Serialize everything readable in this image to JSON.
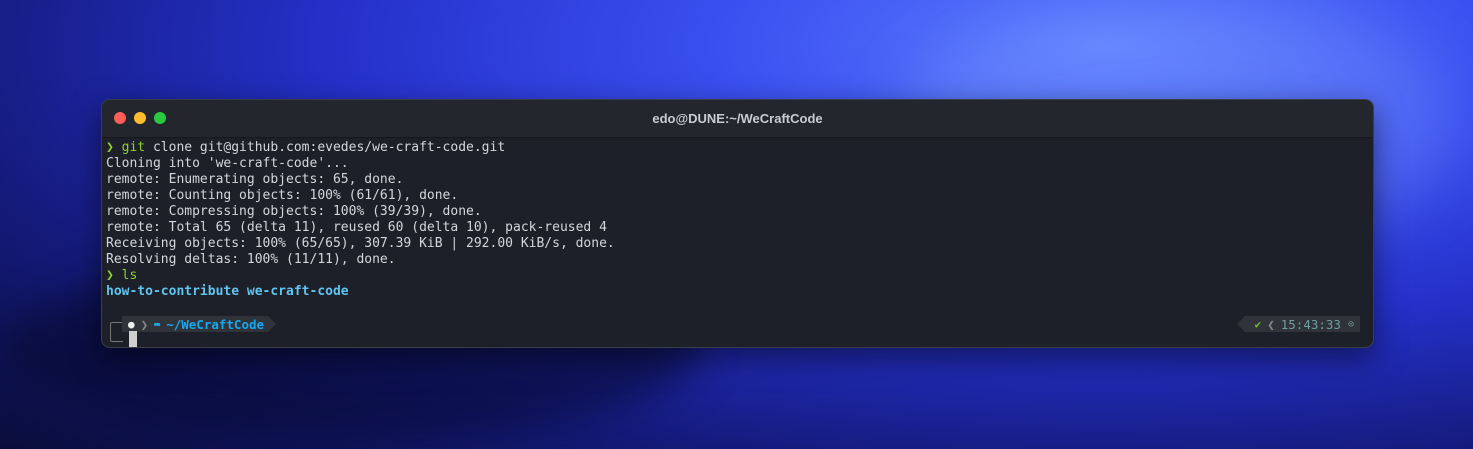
{
  "window": {
    "title": "edo@DUNE:~/WeCraftCode",
    "buttons": {
      "close_color": "#ff5f57",
      "minimize_color": "#febc2e",
      "zoom_color": "#28c840"
    }
  },
  "terminal": {
    "lines": [
      {
        "prompt": "❯",
        "text": "git clone git@github.com:evedes/we-craft-code.git"
      },
      {
        "text": "Cloning into 'we-craft-code'..."
      },
      {
        "text": "remote: Enumerating objects: 65, done."
      },
      {
        "text": "remote: Counting objects: 100% (61/61), done."
      },
      {
        "text": "remote: Compressing objects: 100% (39/39), done."
      },
      {
        "text": "remote: Total 65 (delta 11), reused 60 (delta 10), pack-reused 4"
      },
      {
        "text": "Receiving objects: 100% (65/65), 307.39 KiB | 292.00 KiB/s, done."
      },
      {
        "text": "Resolving deltas: 100% (11/11), done."
      },
      {
        "prompt": "❯",
        "text": "ls"
      },
      {
        "text": "how-to-contribute we-craft-code",
        "style": "directory"
      }
    ],
    "prompt_left": {
      "os_icon": "apple-icon",
      "separator": "❯",
      "folder_icon": "folder-icon",
      "path": "~/WeCraftCode"
    },
    "prompt_right": {
      "status_icon": "check-icon",
      "status": "✔",
      "separator": "❮",
      "time": "15:43:33",
      "clock_icon": "clock-icon"
    }
  }
}
